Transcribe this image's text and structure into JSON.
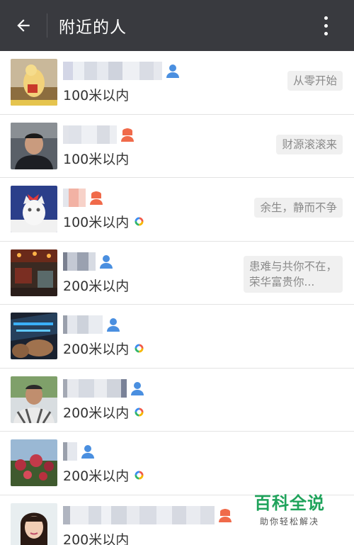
{
  "appbar": {
    "title": "附近的人",
    "background": "#393a3f"
  },
  "icons": {
    "back": "arrow-left-icon",
    "more": "more-vertical-icon",
    "male": "male-user-icon",
    "female": "female-user-icon",
    "moments": "moments-ring-icon"
  },
  "colors": {
    "male": "#4a8fe0",
    "female": "#f06a4a",
    "signature_bg": "#f0f0f0"
  },
  "people": [
    {
      "distance": "100米以内",
      "gender": "male",
      "moments": false,
      "signature": "从零开始"
    },
    {
      "distance": "100米以内",
      "gender": "female",
      "moments": false,
      "signature": "财源滚滚来"
    },
    {
      "distance": "100米以内",
      "gender": "female",
      "moments": true,
      "signature": "余生，静而不争"
    },
    {
      "distance": "200米以内",
      "gender": "male",
      "moments": false,
      "signature": "患难与共你不在，荣华富贵你..."
    },
    {
      "distance": "200米以内",
      "gender": "male",
      "moments": true,
      "signature": ""
    },
    {
      "distance": "200米以内",
      "gender": "male",
      "moments": true,
      "signature": ""
    },
    {
      "distance": "200米以内",
      "gender": "male",
      "moments": true,
      "signature": ""
    },
    {
      "distance": "200米以内",
      "gender": "female",
      "moments": false,
      "signature": ""
    }
  ],
  "watermark": {
    "title": "百科全说",
    "subtitle": "助你轻松解决"
  }
}
